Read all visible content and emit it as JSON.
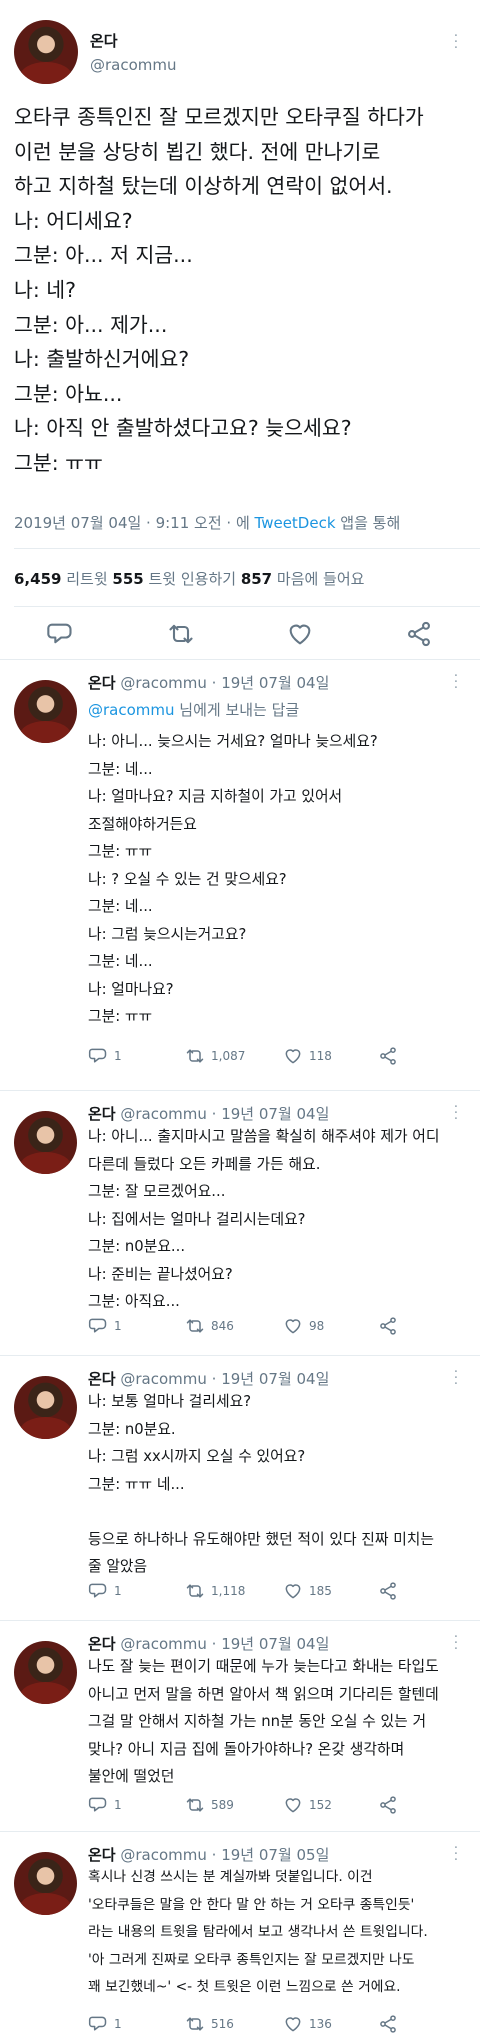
{
  "main": {
    "name": "온다",
    "handle": "@racommu",
    "lines": [
      "오타쿠 종특인진 잘 모르겠지만 오타쿠질 하다가",
      "이런 분을 상당히 뵙긴 했다. 전에 만나기로",
      "하고 지하철 탔는데 이상하게 연락이 없어서.",
      "나: 어디세요?",
      "그분: 아... 저 지금...",
      "나: 네?",
      "그분: 아... 제가...",
      "나: 출발하신거에요?",
      "그분: 아뇨...",
      "나: 아직 안 출발하셨다고요? 늦으세요?",
      "그분: ㅠㅠ"
    ],
    "meta_time": "2019년 07월 04일 · 9:11 오전 · 에 ",
    "meta_client": "TweetDeck",
    "meta_suffix": " 앱을 통해",
    "retweets": "6,459",
    "retweets_label": " 리트윗 ",
    "quotes": "555",
    "quotes_label": " 트윗 인용하기 ",
    "likes": "857",
    "likes_label": " 마음에 들어요"
  },
  "replies": [
    {
      "name": "온다",
      "handle_date": "@racommu · 19년 07월 04일",
      "reply_to_handle": "@racommu",
      "reply_to_suffix": " 님에게 보내는 답글",
      "lines": [
        "나: 아니... 늦으시는 거세요? 얼마나 늦으세요?",
        "그분: 네...",
        "나: 얼마나요? 지금 지하철이 가고 있어서",
        "조절해야하거든요",
        "그분: ㅠㅠ",
        "나: ? 오실 수 있는 건 맞으세요?",
        "그분: 네...",
        "나: 그럼 늦으시는거고요?",
        "그분: 네...",
        "나: 얼마나요?",
        "그분: ㅠㅠ"
      ],
      "replies_count": "1",
      "retweets_count": "1,087",
      "likes_count": "118"
    },
    {
      "name": "온다",
      "handle_date": "@racommu · 19년 07월 04일",
      "lines": [
        "나: 아니... 출지마시고 말씀을 확실히 해주셔야 제가 어디",
        "다른데 들렀다 오든 카페를 가든 해요.",
        "그분: 잘 모르겠어요...",
        "나: 집에서는 얼마나 걸리시는데요?",
        "그분: n0분요...",
        "나: 준비는 끝나셨어요?",
        "그분: 아직요..."
      ],
      "replies_count": "1",
      "retweets_count": "846",
      "likes_count": "98"
    },
    {
      "name": "온다",
      "handle_date": "@racommu · 19년 07월 04일",
      "lines": [
        "나: 보통 얼마나 걸리세요?",
        "그분: n0분요.",
        "나: 그럼 xx시까지 오실 수 있어요?",
        "그분: ㅠㅠ 네...",
        "",
        "등으로 하나하나 유도해야만 했던 적이 있다 진짜 미치는",
        "줄 알았음"
      ],
      "replies_count": "1",
      "retweets_count": "1,118",
      "likes_count": "185"
    },
    {
      "name": "온다",
      "handle_date": "@racommu · 19년 07월 04일",
      "lines": [
        "나도 잘 늦는 편이기 때문에 누가 늦는다고 화내는 타입도",
        "아니고 먼저 말을 하면 알아서 책 읽으며 기다리든 할텐데",
        "그걸 말 안해서 지하철 가는 nn분 동안 오실 수 있는 거",
        "맞나? 아니 지금 집에 돌아가야하나? 온갖 생각하며",
        "불안에 떨었던"
      ],
      "replies_count": "1",
      "retweets_count": "589",
      "likes_count": "152"
    },
    {
      "name": "온다",
      "handle_date": "@racommu · 19년 07월 05일",
      "lines": [
        "혹시나 신경 쓰시는 분 계실까봐 덧붙입니다. 이건",
        "'오타쿠들은 말을 안 한다 말 안 하는 거 오타쿠 종특인듯'",
        "라는 내용의 트윗을 탐라에서 보고 생각나서 쓴 트윗입니다.",
        "'아 그러게 진짜로 오타쿠 종특인지는 잘 모르겠지만 나도",
        "꽤 보긴했네~' <- 첫 트윗은 이런 느낌으로 쓴 거에요."
      ],
      "replies_count": "1",
      "retweets_count": "516",
      "likes_count": "136"
    }
  ]
}
